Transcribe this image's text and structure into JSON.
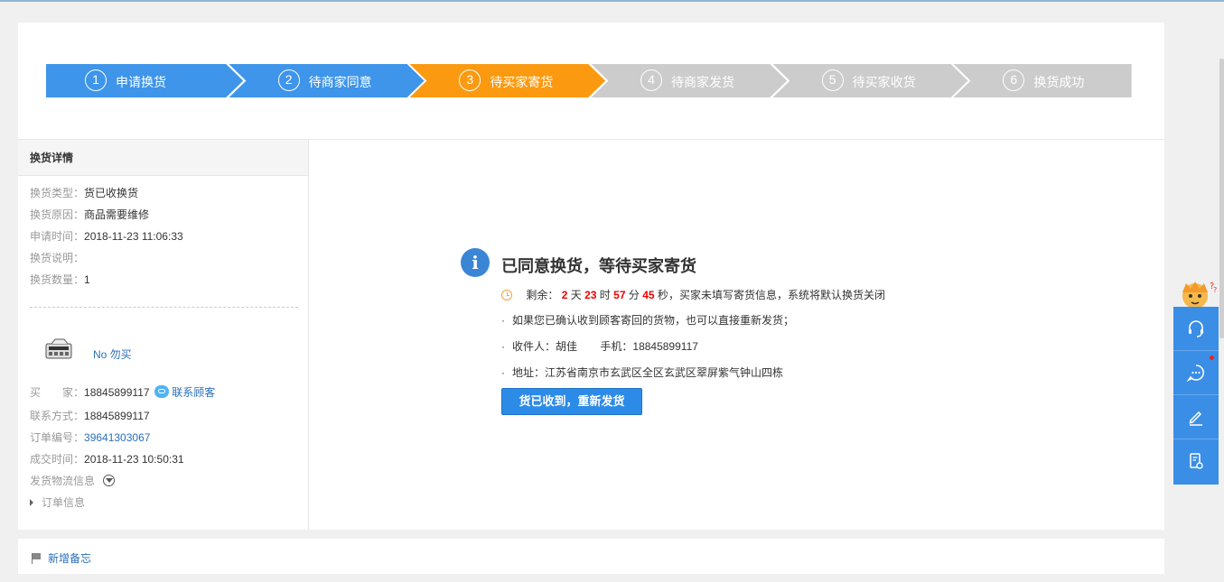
{
  "steps": [
    {
      "num": "1",
      "label": "申请换货",
      "state": "done"
    },
    {
      "num": "2",
      "label": "待商家同意",
      "state": "done"
    },
    {
      "num": "3",
      "label": "待买家寄货",
      "state": "current"
    },
    {
      "num": "4",
      "label": "待商家发货",
      "state": "todo"
    },
    {
      "num": "5",
      "label": "待买家收货",
      "state": "todo"
    },
    {
      "num": "6",
      "label": "换货成功",
      "state": "todo"
    }
  ],
  "colors": {
    "done": "#3e95ea",
    "current": "#fb9a11",
    "todo": "#cccccc"
  },
  "detail": {
    "heading": "换货详情",
    "type_label": "换货类型：",
    "type_value": "货已收换货",
    "reason_label": "换货原因：",
    "reason_value": "商品需要维修",
    "time_label": "申请时间：",
    "time_value": "2018-11-23 11:06:33",
    "desc_label": "换货说明：",
    "desc_value": "",
    "qty_label": "换货数量：",
    "qty_value": "1",
    "product_name": "No 勿买",
    "buyer_label": "买　　家：",
    "buyer_value": "18845899117",
    "contact_link": "联系顾客",
    "contact_label": "联系方式：",
    "contact_value": "18845899117",
    "order_label": "订单编号：",
    "order_value": "39641303067",
    "deal_label": "成交时间：",
    "deal_value": "2018-11-23 10:50:31",
    "logistics_label": "发货物流信息",
    "order_info_label": "订单信息"
  },
  "status": {
    "title": "已同意换货，等待买家寄货",
    "countdown_prefix": "剩余：",
    "days": "2",
    "days_unit": "天",
    "hours": "23",
    "hours_unit": "时",
    "minutes": "57",
    "minutes_unit": "分",
    "seconds": "45",
    "seconds_unit": "秒",
    "countdown_suffix": "，买家未填写寄货信息，系统将默认换货关闭",
    "note": "如果您已确认收到顾客寄回的货物，也可以直接重新发货；",
    "receiver_label": "收件人：",
    "receiver_value": "胡佳",
    "phone_label": "手机：",
    "phone_value": "18845899117",
    "address_label": "地址：",
    "address_value": "江苏省南京市玄武区全区玄武区翠屏紫气钟山四栋",
    "button": "货已收到，重新发货"
  },
  "memo": {
    "label": "新增备忘"
  },
  "sidebar": {
    "icons": [
      "headset-icon",
      "chat-icon",
      "edit-icon",
      "phone-doc-icon"
    ]
  }
}
